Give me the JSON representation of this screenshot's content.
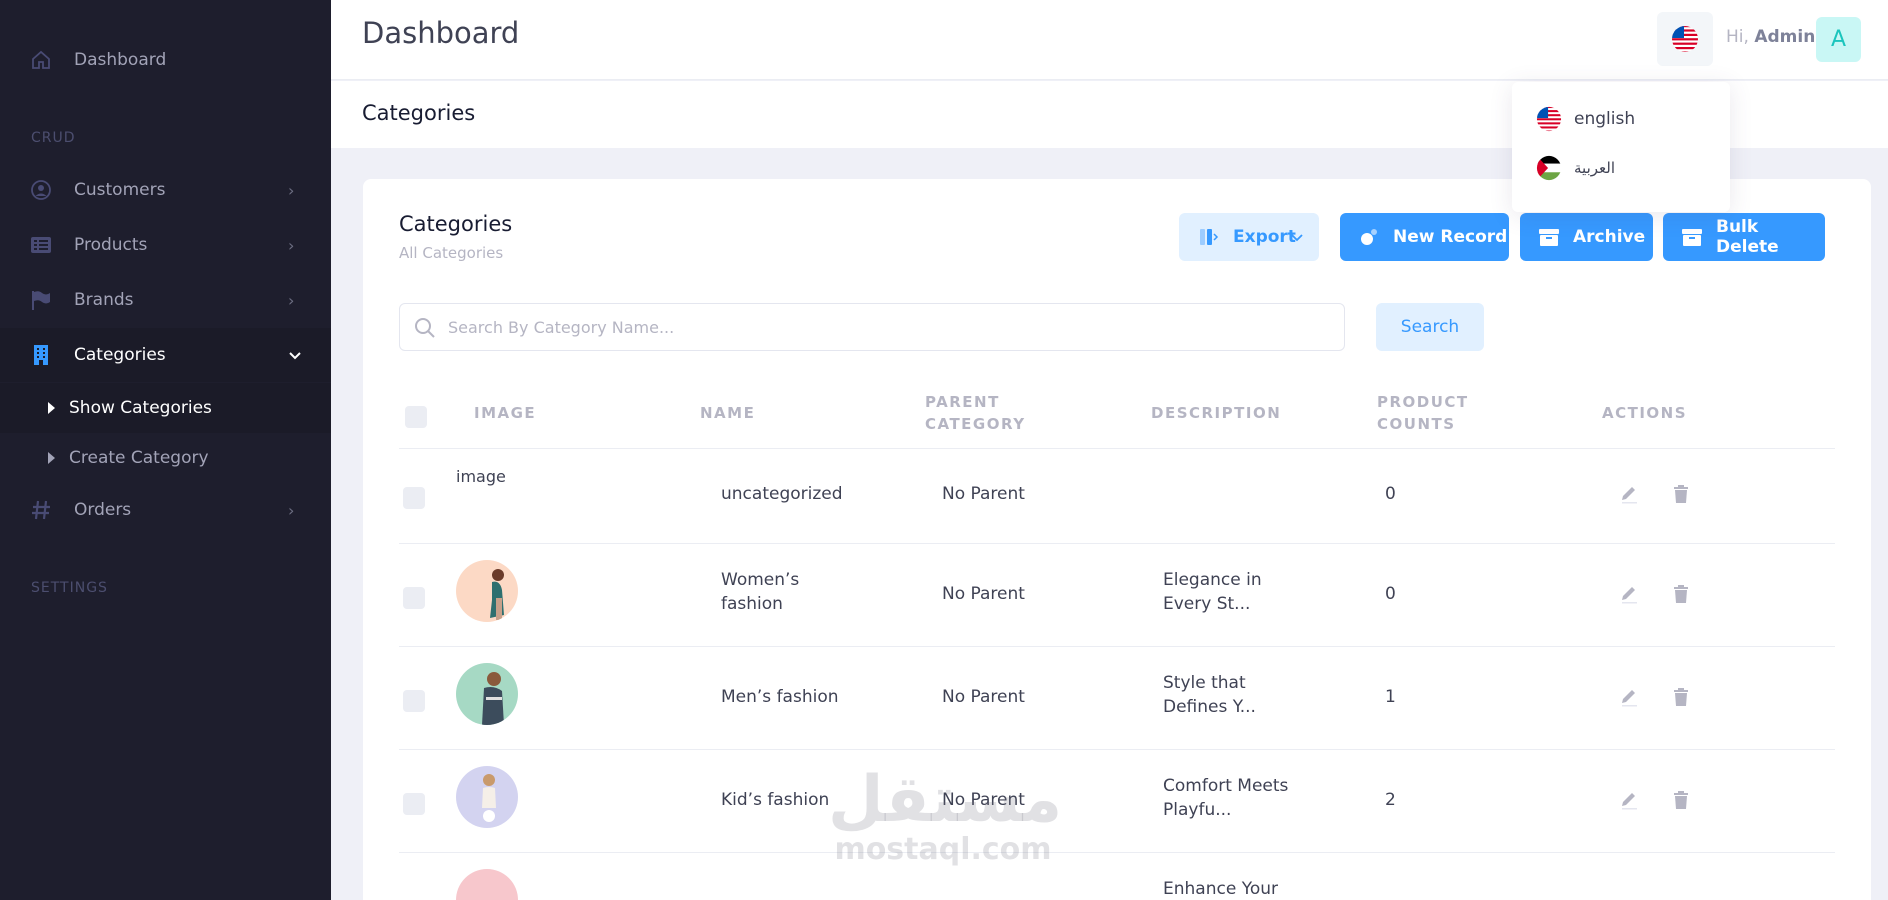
{
  "sidebar": {
    "dashboard": "Dashboard",
    "section_crud": "CRUD",
    "customers": "Customers",
    "products": "Products",
    "brands": "Brands",
    "categories": "Categories",
    "show_categories": "Show Categories",
    "create_category": "Create Category",
    "orders": "Orders",
    "section_settings": "SETTINGS"
  },
  "header": {
    "title": "Dashboard",
    "greeting": "Hi,",
    "user": "Admin",
    "avatar_letter": "A"
  },
  "subheader": {
    "title": "Categories"
  },
  "language_menu": {
    "items": [
      {
        "label": "english",
        "flag": "us-flag-icon"
      },
      {
        "label": "العربية",
        "flag": "palestine-flag-icon"
      }
    ]
  },
  "card": {
    "title": "Categories",
    "subtitle": "All Categories",
    "export_label": "Export",
    "new_record_label": "New Record",
    "archive_label": "Archive",
    "bulk_delete_label": "Bulk Delete",
    "search_placeholder": "Search By Category Name...",
    "search_button": "Search"
  },
  "table": {
    "columns": {
      "image": "IMAGE",
      "name": "NAME",
      "parent_1": "PARENT",
      "parent_2": "CATEGORY",
      "description": "DESCRIPTION",
      "counts_1": "PRODUCT",
      "counts_2": "COUNTS",
      "actions": "ACTIONS"
    },
    "rows": [
      {
        "image_alt": "image",
        "name": "uncategorized",
        "parent": "No Parent",
        "description": "",
        "count": "0"
      },
      {
        "name_1": "Women’s",
        "name_2": "fashion",
        "parent": "No Parent",
        "desc_1": "Elegance in",
        "desc_2": "Every St...",
        "count": "0"
      },
      {
        "name": "Men’s fashion",
        "parent": "No Parent",
        "desc_1": "Style that",
        "desc_2": "Defines Y...",
        "count": "1"
      },
      {
        "name": "Kid’s fashion",
        "parent": "No Parent",
        "desc_1": "Comfort Meets",
        "desc_2": "Playfu...",
        "count": "2"
      },
      {
        "desc_1": "Enhance Your"
      }
    ]
  },
  "watermark": {
    "arabic": "مستقل",
    "latin": "mostaql.com"
  },
  "colors": {
    "sidebar_bg": "#1e1e2d",
    "primary": "#3699ff",
    "primary_light": "#e1f0ff",
    "avatar_bg": "#c9f7f5",
    "avatar_fg": "#1bc5bd"
  }
}
